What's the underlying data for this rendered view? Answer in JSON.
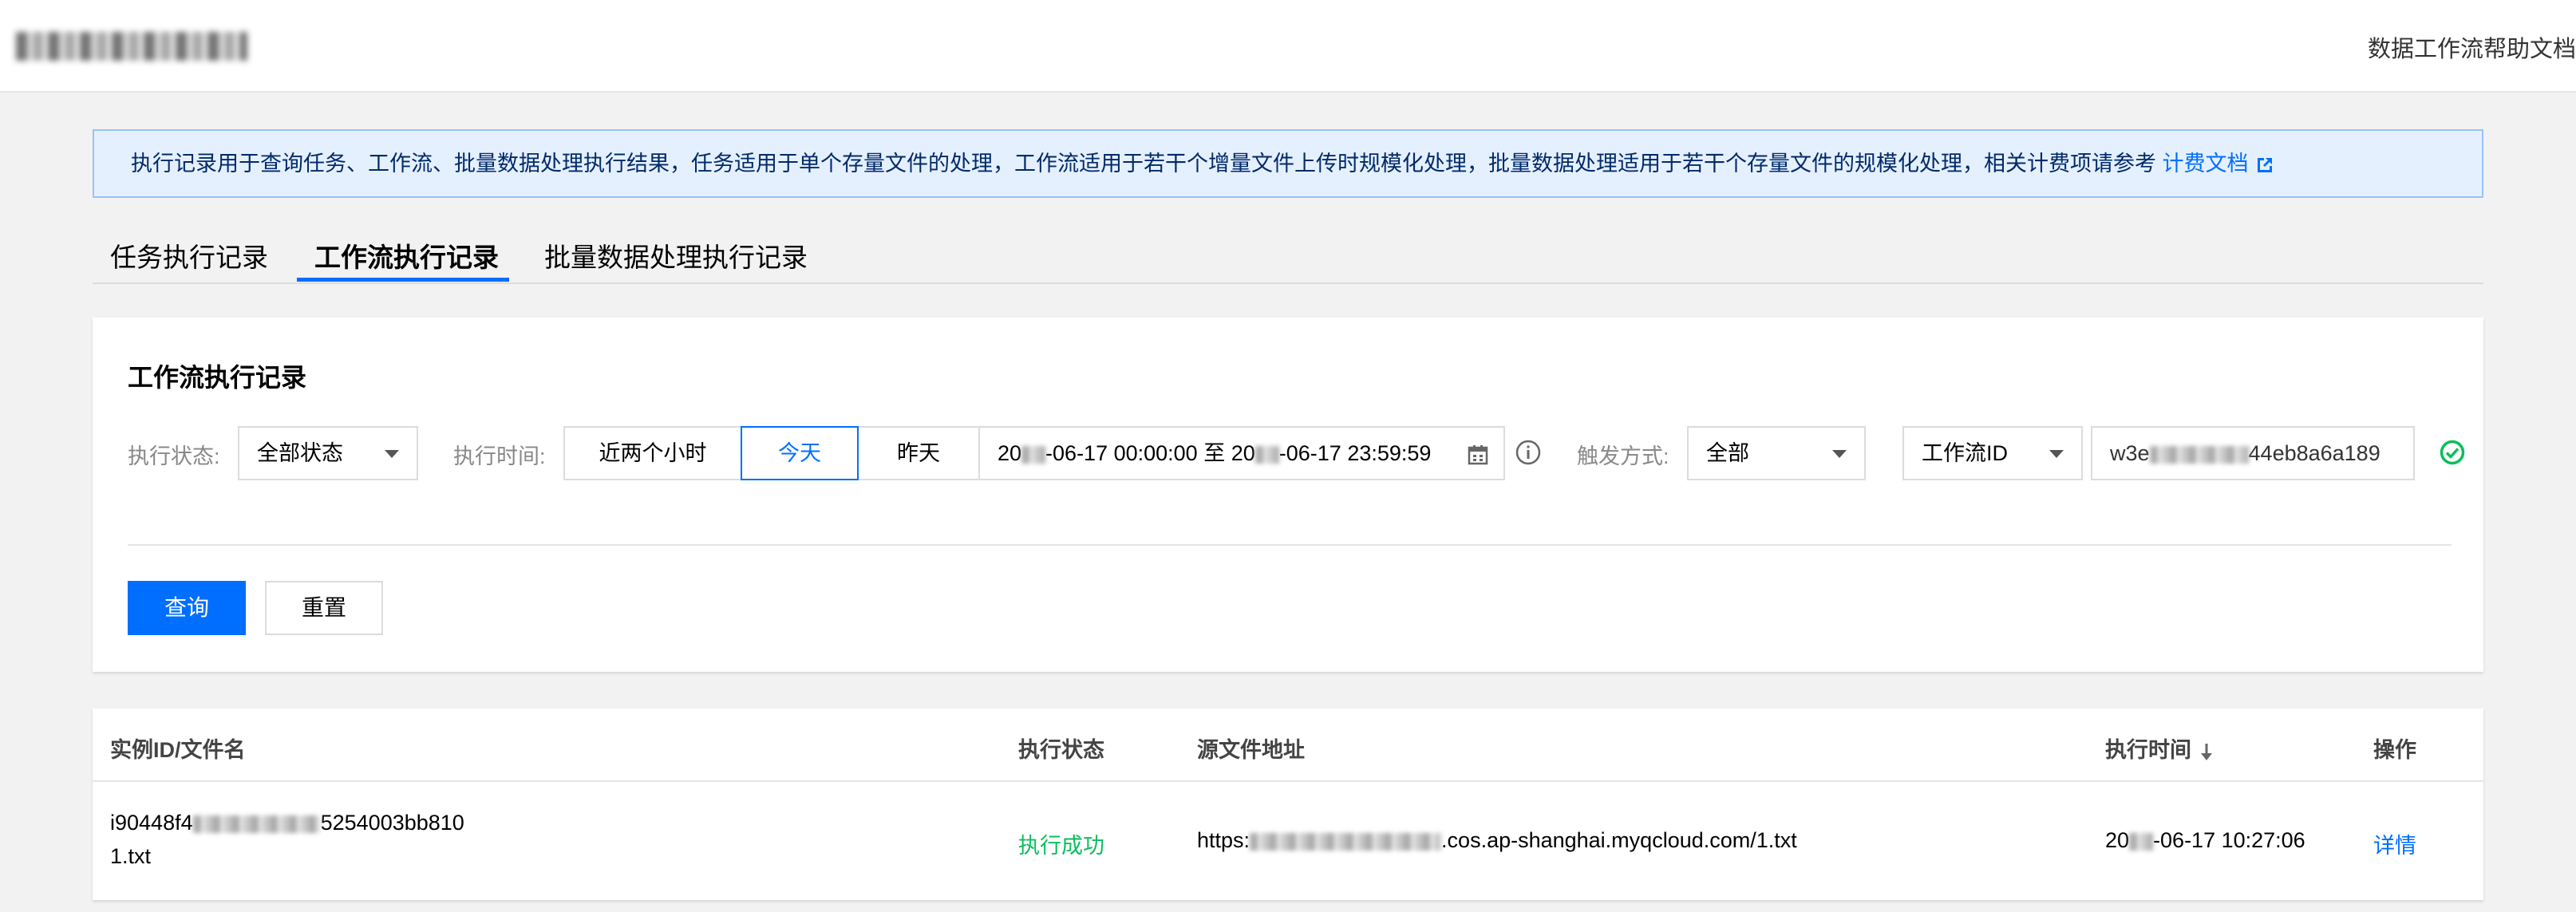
{
  "header": {
    "help_link": "数据工作流帮助文档"
  },
  "notice": {
    "text": "执行记录用于查询任务、工作流、批量数据处理执行结果，任务适用于单个存量文件的处理，工作流适用于若干个增量文件上传时规模化处理，批量数据处理适用于若干个存量文件的规模化处理，相关计费项请参考",
    "link_label": "计费文档",
    "link_icon": "external-link-icon"
  },
  "tabs": [
    {
      "label": "任务执行记录",
      "active": false
    },
    {
      "label": "工作流执行记录",
      "active": true
    },
    {
      "label": "批量数据处理执行记录",
      "active": false
    }
  ],
  "filter": {
    "title": "工作流执行记录",
    "status_label": "执行状态:",
    "status_value": "全部状态",
    "time_label": "执行时间:",
    "time_options": [
      {
        "label": "近两个小时",
        "active": false
      },
      {
        "label": "今天",
        "active": true
      },
      {
        "label": "昨天",
        "active": false
      }
    ],
    "date_start_prefix": "20",
    "date_start_suffix": "-06-17 00:00:00",
    "date_sep": "至",
    "date_end_prefix": "20",
    "date_end_suffix": "-06-17 23:59:59",
    "trigger_label": "触发方式:",
    "trigger_value": "全部",
    "id_type_value": "工作流ID",
    "id_value_prefix": "w3e",
    "id_value_suffix": "44eb8a6a189",
    "query_button": "查询",
    "reset_button": "重置"
  },
  "table": {
    "columns": [
      "实例ID/文件名",
      "执行状态",
      "源文件地址",
      "执行时间",
      "操作"
    ],
    "rows": [
      {
        "instance_id_prefix": "i90448f4",
        "instance_id_suffix": "5254003bb810",
        "file_name": "1.txt",
        "status": "执行成功",
        "source_prefix": "https:",
        "source_suffix": ".cos.ap-shanghai.myqcloud.com/1.txt",
        "time_prefix": "20",
        "time_suffix": "-06-17 10:27:06",
        "action": "详情"
      }
    ]
  },
  "colors": {
    "accent": "#006eff",
    "success": "#0abf5b",
    "notice_bg": "#e5f0ff"
  }
}
